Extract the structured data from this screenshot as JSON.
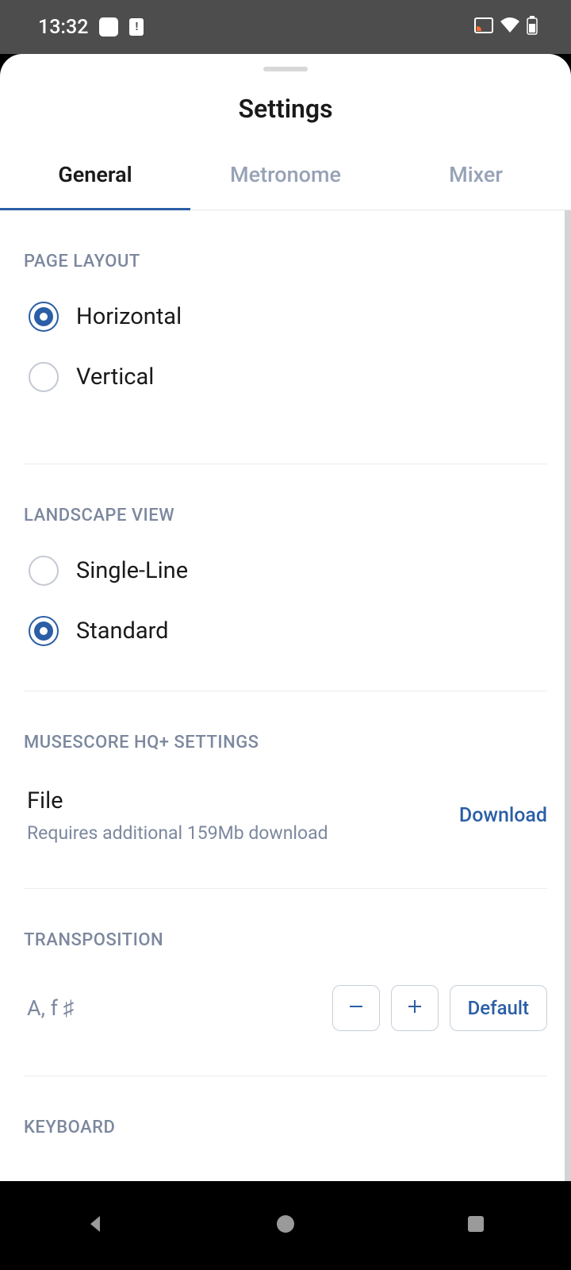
{
  "status": {
    "time": "13:32"
  },
  "header": {
    "title": "Settings"
  },
  "tabs": [
    {
      "label": "General",
      "active": true
    },
    {
      "label": "Metronome",
      "active": false
    },
    {
      "label": "Mixer",
      "active": false
    }
  ],
  "sections": {
    "page_layout": {
      "header": "PAGE LAYOUT",
      "options": [
        {
          "label": "Horizontal",
          "selected": true
        },
        {
          "label": "Vertical",
          "selected": false
        }
      ]
    },
    "landscape_view": {
      "header": "LANDSCAPE VIEW",
      "options": [
        {
          "label": "Single-Line",
          "selected": false
        },
        {
          "label": "Standard",
          "selected": true
        }
      ]
    },
    "hq_settings": {
      "header": "MUSESCORE HQ+ SETTINGS",
      "file_title": "File",
      "file_subtitle": "Requires additional 159Mb download",
      "download_label": "Download"
    },
    "transposition": {
      "header": "TRANSPOSITION",
      "value": "A, f ♯",
      "default_label": "Default"
    },
    "keyboard": {
      "header": "KEYBOARD"
    }
  }
}
